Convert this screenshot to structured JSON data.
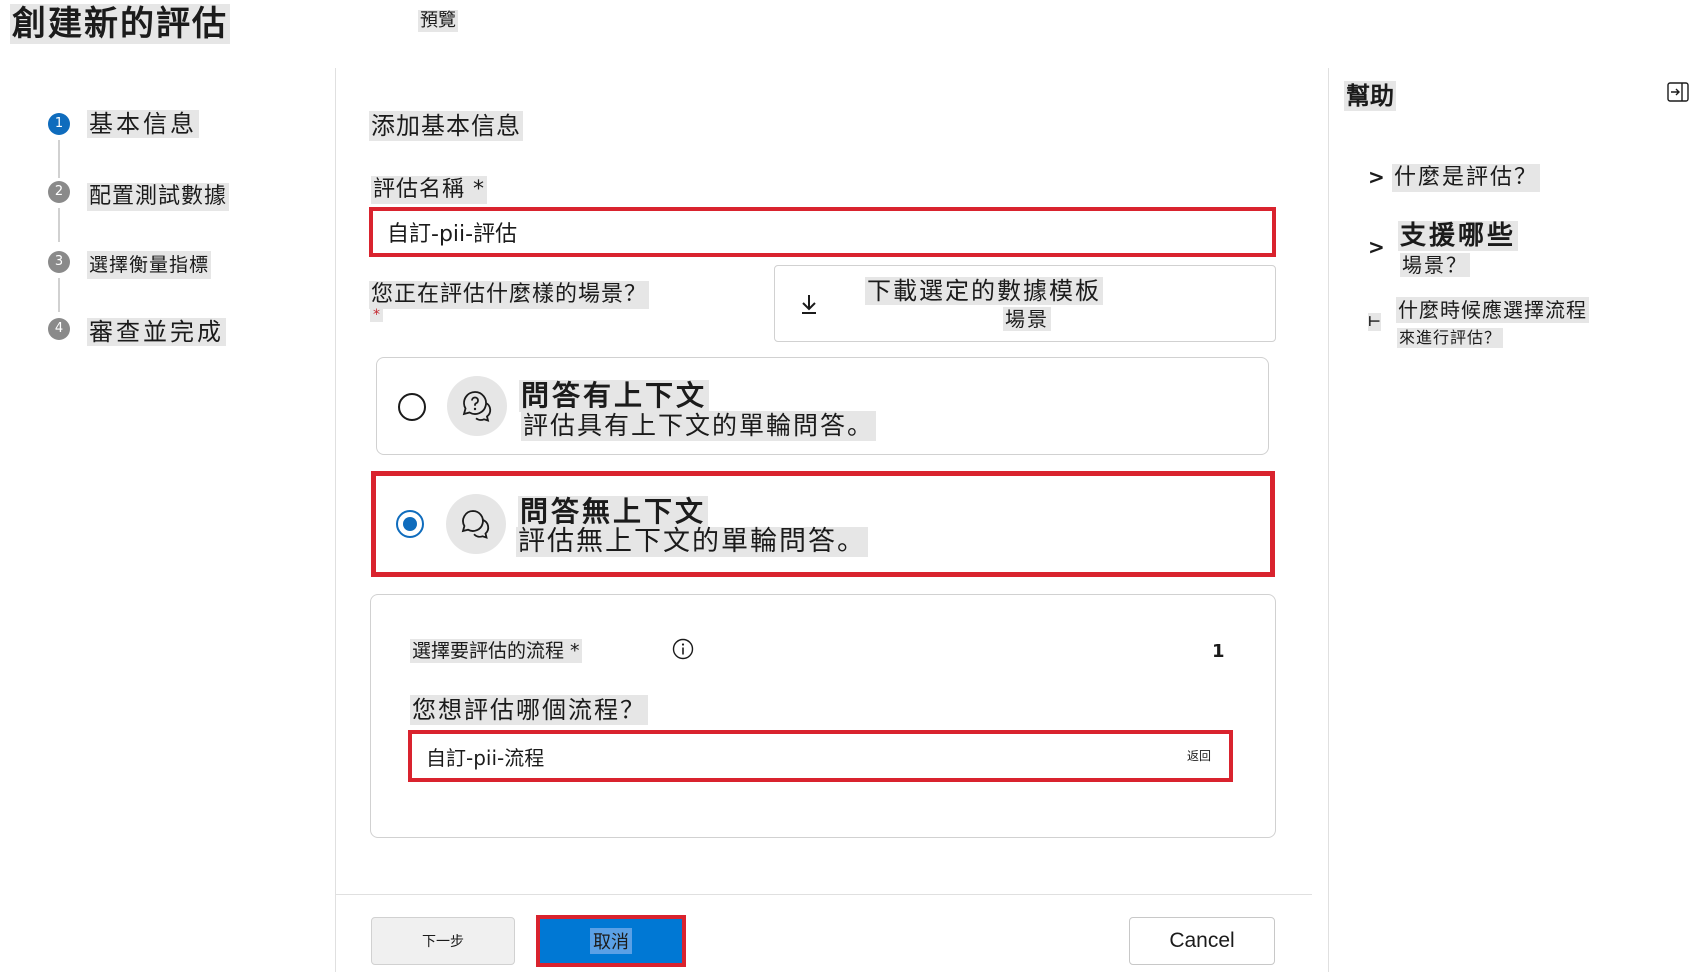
{
  "header": {
    "title": "創建新的評估",
    "badge": "預覽"
  },
  "steps": [
    {
      "number": "1",
      "label": "基本信息"
    },
    {
      "number": "2",
      "label": "配置測試數據"
    },
    {
      "number": "3",
      "label": "選擇衡量指標"
    },
    {
      "number": "4",
      "label": "審查並完成"
    }
  ],
  "main": {
    "section_title": "添加基本信息",
    "name_label": "評估名稱 *",
    "name_value": "自訂-pii-評估",
    "scenario_label": "您正在評估什麼樣的場景？",
    "scenario_required": "*",
    "download_label_line1": "下載選定的數據模板",
    "download_label_line2": "場景",
    "options": [
      {
        "title": "問答有上下文",
        "description": "評估具有上下文的單輪問答。",
        "selected": false
      },
      {
        "title": "問答無上下文",
        "description": "評估無上下文的單輪問答。",
        "selected": true
      }
    ],
    "flow_panel": {
      "label": "選擇要評估的流程 *",
      "count": "1",
      "question": "您想評估哪個流程？",
      "flow_value": "自訂-pii-流程",
      "flow_hint": "返回"
    }
  },
  "footer": {
    "next_label": "下一步",
    "cancel_label": "取消",
    "cancel_en_label": "Cancel"
  },
  "help": {
    "title": "幫助",
    "items": [
      {
        "chevron": ">",
        "line1": "什麼是評估？"
      },
      {
        "chevron": ">",
        "line1": "支援哪些",
        "line2": "場景？"
      },
      {
        "chevron": "⊢",
        "line1": "什麼時候應選擇流程",
        "line2": "來進行評估？"
      }
    ]
  },
  "colors": {
    "accent": "#0f6cbd",
    "highlight_border": "#d9232e",
    "primary_button": "#0078d4"
  }
}
